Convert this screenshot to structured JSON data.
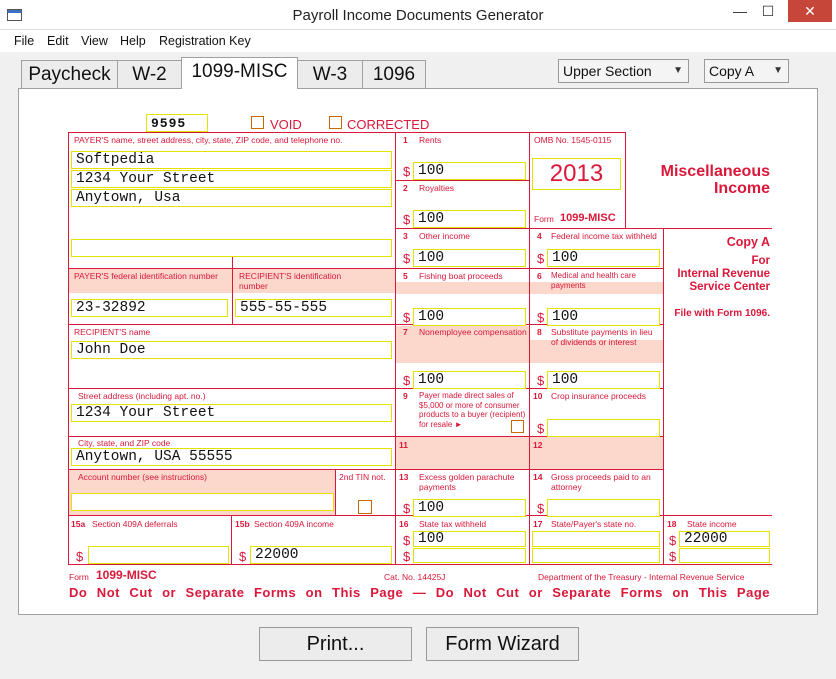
{
  "window": {
    "title": "Payroll Income Documents Generator",
    "minimize": "—",
    "maximize": "☐",
    "close": "✕"
  },
  "menu": [
    "File",
    "Edit",
    "View",
    "Help",
    "Registration Key"
  ],
  "tabs": [
    "Paycheck",
    "W-2",
    "1099-MISC",
    "W-3",
    "1096"
  ],
  "active_tab": "1099-MISC",
  "selects": {
    "section": "Upper Section",
    "copy": "Copy A",
    "arrow": "▼"
  },
  "form": {
    "code": "9595",
    "void": "VOID",
    "corrected": "CORRECTED",
    "payer_label": "PAYER'S name, street address, city, state, ZIP code, and telephone no.",
    "payer_lines": [
      "Softpedia",
      "1234 Your Street",
      "Anytown, Usa",
      ""
    ],
    "rents": {
      "num": "1",
      "label": "Rents",
      "value": "100"
    },
    "royalties": {
      "num": "2",
      "label": "Royalties",
      "value": "100"
    },
    "omb": "OMB No. 1545-0115",
    "year": "2013",
    "form_word": "Form",
    "form_name": "1099-MISC",
    "misc_title": [
      "Miscellaneous",
      "Income"
    ],
    "other_income": {
      "num": "3",
      "label": "Other income",
      "value": "100"
    },
    "fed_tax": {
      "num": "4",
      "label": "Federal income tax withheld",
      "value": "100"
    },
    "copy_block": [
      "Copy A",
      "For",
      "Internal Revenue",
      "Service Center",
      "File with Form 1096."
    ],
    "payer_id_label": "PAYER'S federal identification number",
    "payer_id": "23-32892",
    "recip_id_label": "RECIPIENT'S identification number",
    "recip_id": "555-55-555",
    "fishing": {
      "num": "5",
      "label": "Fishing boat proceeds",
      "value": "100"
    },
    "medical": {
      "num": "6",
      "label": "Medical and health care payments",
      "value": "100"
    },
    "recip_name_label": "RECIPIENT'S name",
    "recip_name": "John Doe",
    "nonemp": {
      "num": "7",
      "label": "Nonemployee compensation",
      "value": "100"
    },
    "subst": {
      "num": "8",
      "label": "Substitute payments in lieu of dividends or interest",
      "value": "100"
    },
    "street_label": "Street address (including apt. no.)",
    "street": "1234 Your Street",
    "direct_sales": {
      "num": "9",
      "label": "Payer made direct sales of $5,000 or more of consumer products to a buyer (recipient) for resale ►"
    },
    "crop": {
      "num": "10",
      "label": "Crop insurance proceeds",
      "value": ""
    },
    "city_label": "City, state, and ZIP code",
    "city": "Anytown, USA 55555",
    "box11": "11",
    "box12": "12",
    "account_label": "Account number (see instructions)",
    "account": "",
    "tin_label": "2nd TIN not.",
    "golden": {
      "num": "13",
      "label": "Excess golden parachute payments",
      "value": "100"
    },
    "gross": {
      "num": "14",
      "label": "Gross proceeds paid to an attorney",
      "value": ""
    },
    "s15a": {
      "num": "15a",
      "label": "Section 409A deferrals",
      "value": ""
    },
    "s15b": {
      "num": "15b",
      "label": "Section 409A income",
      "value": "22000"
    },
    "s16": {
      "num": "16",
      "label": "State tax withheld",
      "value1": "100",
      "value2": ""
    },
    "s17": {
      "num": "17",
      "label": "State/Payer's state no.",
      "value1": "",
      "value2": ""
    },
    "s18": {
      "num": "18",
      "label": "State income",
      "value1": "22000",
      "value2": ""
    },
    "dollar": "$",
    "footer": {
      "form_word": "Form",
      "form_name": "1099-MISC",
      "cat": "Cat. No. 14425J",
      "dept": "Department of the Treasury - Internal Revenue Service",
      "notice": "Do Not Cut or Separate Forms on This Page — Do Not Cut or Separate Forms on This Page"
    }
  },
  "buttons": {
    "print": "Print...",
    "wizard": "Form Wizard"
  }
}
